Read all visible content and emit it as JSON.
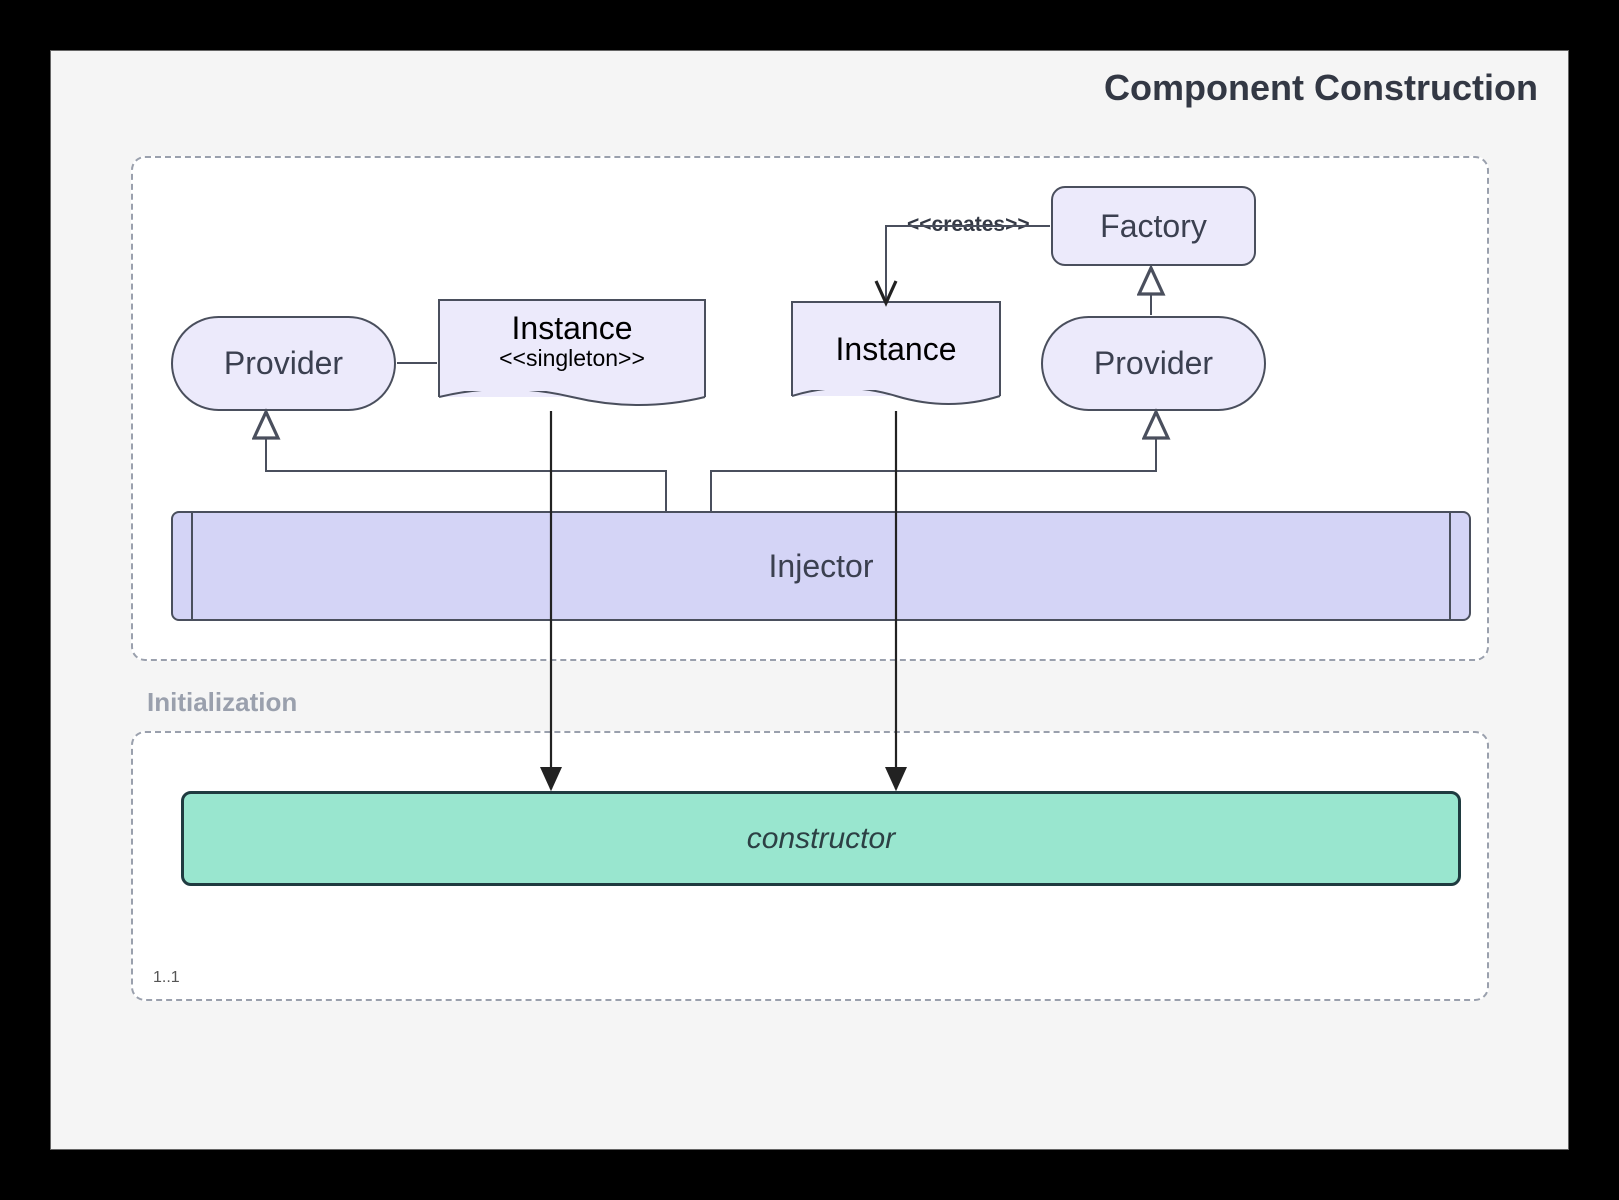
{
  "title": "Component Construction",
  "regions": {
    "lower": {
      "title": "Initialization",
      "multiplicity": "1..1"
    }
  },
  "nodes": {
    "provider1": "Provider",
    "instance1_main": "Instance",
    "instance1_sub": "<<singleton>>",
    "instance2": "Instance",
    "provider2": "Provider",
    "factory": "Factory",
    "injector": "Injector",
    "constructor": "constructor"
  },
  "edges": {
    "creates": "<<creates>>"
  },
  "colors": {
    "frame_bg": "#f5f5f5",
    "node_fill": "#eceafb",
    "injector_fill": "#d4d4f6",
    "constructor_fill": "#99e6cf",
    "stroke": "#4a4f5d"
  }
}
